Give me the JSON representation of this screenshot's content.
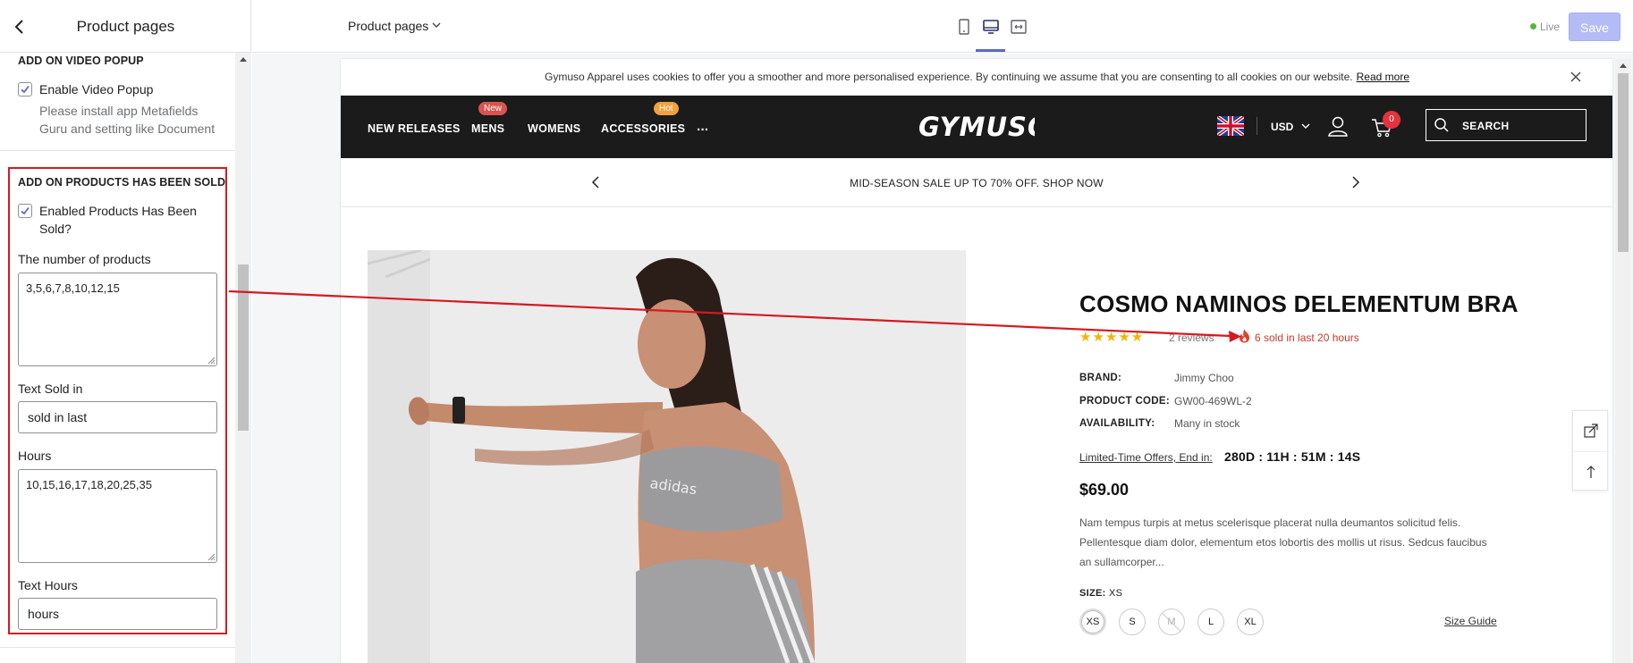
{
  "sidebar": {
    "title": "Product pages",
    "video_section": {
      "title": "ADD ON VIDEO POPUP",
      "checkbox_label": "Enable Video Popup",
      "help_line1": "Please install app Metafields",
      "help_line2": "Guru and setting like Document"
    },
    "sold_section": {
      "title": "ADD ON PRODUCTS HAS BEEN SOLD",
      "checkbox_label_line1": "Enabled Products Has Been",
      "checkbox_label_line2": "Sold?",
      "number_label": "The number of products",
      "number_value": "3,5,6,7,8,10,12,15",
      "text_sold_label": "Text Sold in",
      "text_sold_value": "sold in last",
      "hours_label": "Hours",
      "hours_value": "10,15,16,17,18,20,25,35",
      "text_hours_label": "Text Hours",
      "text_hours_value": "hours"
    }
  },
  "topbar": {
    "page_selector": "Product pages",
    "live_label": "Live",
    "save_label": "Save"
  },
  "store": {
    "cookie_text": "Gymuso Apparel uses cookies to offer you a smoother and more personalised experience. By continuing we assume that you are consenting to all cookies on our website.",
    "cookie_link": "Read more",
    "nav_items": [
      "NEW RELEASES",
      "MENS",
      "WOMENS",
      "ACCESSORIES",
      "..."
    ],
    "badge_new": "New",
    "badge_hot": "Hot",
    "logo_text": "GYMUSO",
    "currency": "USD",
    "cart_count": "0",
    "search_placeholder": "SEARCH",
    "promo": "MID-SEASON SALE UP TO 70% OFF. SHOP NOW"
  },
  "product": {
    "title": "COSMO NAMINOS DELEMENTUM BRA",
    "stars": "★★★★★",
    "rating": 5,
    "reviews": "2 reviews",
    "sold_text": "6 sold in last 20 hours",
    "brand_label": "BRAND:",
    "brand": "Jimmy Choo",
    "code_label": "PRODUCT CODE:",
    "code": "GW00-469WL-2",
    "avail_label": "AVAILABILITY:",
    "availability": "Many in stock",
    "offer_label": "Limited-Time Offers, End in:",
    "countdown": "280D : 11H : 51M : 14S",
    "price": "$69.00",
    "description": "Nam tempus turpis at metus scelerisque placerat nulla deumantos solicitud felis. Pellentesque diam dolor, elementum etos lobortis des mollis ut risus. Sedcus faucibus an sullamcorper...",
    "size_label": "SIZE:",
    "size_selected": "XS",
    "sizes": [
      "XS",
      "S",
      "M",
      "L",
      "XL"
    ],
    "size_guide": "Size Guide"
  },
  "colors": {
    "highlight_red": "#d71920",
    "accent": "#5c6ac4",
    "live_green": "#50b83c",
    "nav_bg": "#1b1b1b",
    "star": "#f5b400",
    "sold_red": "#c8392b"
  }
}
